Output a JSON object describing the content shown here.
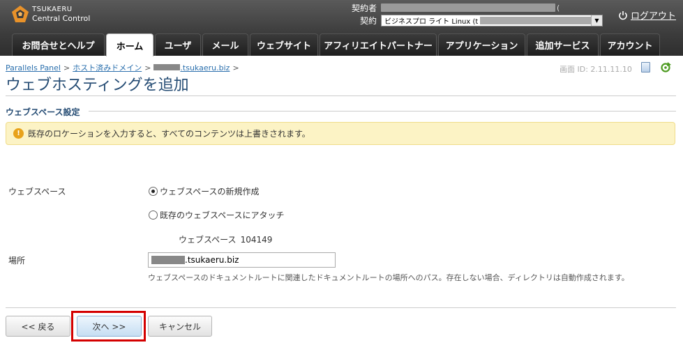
{
  "header": {
    "logo_line1": "TSUKAERU",
    "logo_line2": "Central Control",
    "contractor_label": "契約者",
    "contractor_paren": "(",
    "contract_label": "契約",
    "plan_value": "ビジネスプロ ライト Linux (t",
    "logout": "ログアウト"
  },
  "tabs": [
    {
      "label": "お問合せとヘルプ"
    },
    {
      "label": "ホーム"
    },
    {
      "label": "ユーザ"
    },
    {
      "label": "メール"
    },
    {
      "label": "ウェブサイト"
    },
    {
      "label": "アフィリエイトパートナー"
    },
    {
      "label": "アプリケーション"
    },
    {
      "label": "追加サービス"
    },
    {
      "label": "アカウント"
    }
  ],
  "breadcrumb": {
    "item1": "Parallels Panel",
    "item2": "ホスト済みドメイン",
    "item3_suffix": ".tsukaeru.biz",
    "sep": ">"
  },
  "screen_id": "画面 ID:  2.11.11.10",
  "page_title": "ウェブホスティングを追加",
  "section_title": "ウェブスペース設定",
  "warning": "既存のロケーションを入力すると、すべてのコンテンツは上書きされます。",
  "form": {
    "webspace_label": "ウェブスペース",
    "option_new": "ウェブスペースの新規作成",
    "option_attach": "既存のウェブスペースにアタッチ",
    "webspace_name": "ウェブスペース",
    "webspace_number": "104149",
    "location_label": "場所",
    "location_value": ".tsukaeru.biz",
    "location_hint": "ウェブスペースのドキュメントルートに関連したドキュメントルートの場所へのパス。存在しない場合、ディレクトリは自動作成されます。"
  },
  "buttons": {
    "back": "<< 戻る",
    "next": "次へ >>",
    "cancel": "キャンセル"
  },
  "colors": {
    "accent_title": "#244b73",
    "link": "#2a6fad",
    "warning_bg": "#fcf3c5",
    "highlight": "#d40000"
  }
}
